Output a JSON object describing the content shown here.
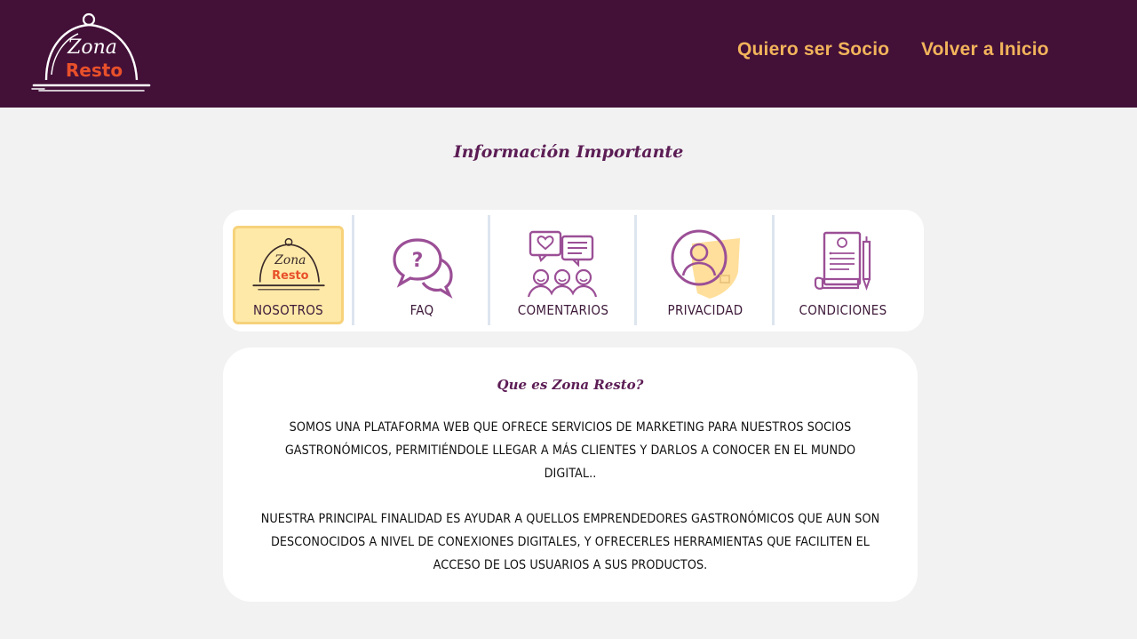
{
  "header": {
    "logo_text_top": "Zona",
    "logo_text_bottom": "Resto",
    "nav": {
      "partner_label": "Quiero ser Socio",
      "home_label": "Volver a Inicio"
    }
  },
  "section": {
    "title": "Información Importante"
  },
  "tabs": [
    {
      "label": "NOSOTROS",
      "icon": "zona-resto-cloche-icon",
      "active": true
    },
    {
      "label": "FAQ",
      "icon": "question-chat-bubbles-icon",
      "active": false
    },
    {
      "label": "COMENTARIOS",
      "icon": "comments-people-icon",
      "active": false
    },
    {
      "label": "PRIVACIDAD",
      "icon": "privacy-shield-user-icon",
      "active": false
    },
    {
      "label": "CONDICIONES",
      "icon": "document-pen-icon",
      "active": false
    }
  ],
  "content": {
    "title": "Que es Zona Resto?",
    "paragraph1": "SOMOS UNA PLATAFORMA WEB QUE OFRECE SERVICIOS DE MARKETING  PARA NUESTROS SOCIOS GASTRONÓMICOS, PERMITIÉNDOLE LLEGAR A MÁS CLIENTES Y DARLOS A CONOCER EN EL MUNDO DIGITAL..",
    "paragraph2": "NUESTRA PRINCIPAL FINALIDAD ES AYUDAR A QUELLOS EMPRENDEDORES GASTRONÓMICOS QUE AUN SON DESCONOCIDOS A NIVEL DE CONEXIONES DIGITALES, Y OFRECERLES HERRAMIENTAS QUE FACILITEN EL ACCESO DE LOS USUARIOS A SUS PRODUCTOS."
  },
  "colors": {
    "header_bg": "#431038",
    "nav_text": "#f2b45b",
    "title_purple": "#5c1d55",
    "active_tab_bg": "#ffe9a8",
    "icon_purple": "#9b4f96",
    "logo_orange": "#e8502a"
  }
}
